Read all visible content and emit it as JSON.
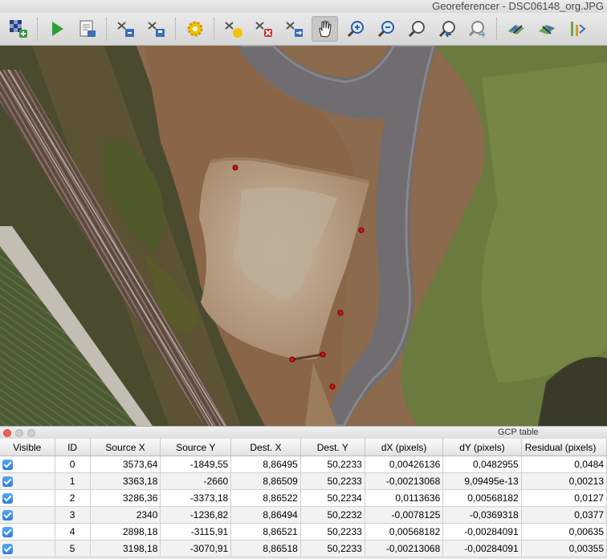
{
  "window": {
    "title": "Georeferencer - DSC06148_org.JPG"
  },
  "toolbar": {
    "buttons": [
      {
        "name": "open-raster-button",
        "icon": "open-raster-icon"
      },
      {
        "name": "start-georeferencing-button",
        "icon": "play-icon"
      },
      {
        "name": "generate-gdal-script-button",
        "icon": "script-icon"
      },
      {
        "name": "load-gcp-points-button",
        "icon": "load-gcp-icon"
      },
      {
        "name": "save-gcp-points-button",
        "icon": "save-gcp-icon"
      },
      {
        "name": "transformation-settings-button",
        "icon": "gear-icon"
      },
      {
        "name": "add-point-button",
        "icon": "add-point-icon"
      },
      {
        "name": "delete-point-button",
        "icon": "delete-point-icon"
      },
      {
        "name": "move-gcp-point-button",
        "icon": "move-point-icon"
      },
      {
        "name": "pan-button",
        "icon": "hand-icon"
      },
      {
        "name": "zoom-in-button",
        "icon": "zoom-in-icon"
      },
      {
        "name": "zoom-out-button",
        "icon": "zoom-out-icon"
      },
      {
        "name": "zoom-to-layer-button",
        "icon": "zoom-layer-icon"
      },
      {
        "name": "zoom-last-button",
        "icon": "zoom-last-icon"
      },
      {
        "name": "zoom-next-button",
        "icon": "zoom-next-icon"
      },
      {
        "name": "link-georeferencer-to-qgis-button",
        "icon": "link-geo-icon"
      },
      {
        "name": "link-qgis-to-georeferencer-button",
        "icon": "link-qgis-icon"
      },
      {
        "name": "full-histogram-stretch-button",
        "icon": "histogram-icon"
      }
    ],
    "active": "pan-button"
  },
  "gcp_panel": {
    "title": "GCP table",
    "columns": [
      "Visible",
      "ID",
      "Source X",
      "Source Y",
      "Dest. X",
      "Dest. Y",
      "dX (pixels)",
      "dY (pixels)",
      "Residual (pixels)"
    ],
    "rows": [
      {
        "visible": true,
        "id": "0",
        "source_x": "3573,64",
        "source_y": "-1849,55",
        "dest_x": "8,86495",
        "dest_y": "50,2233",
        "dx": "0,00426136",
        "dy": "0,0482955",
        "residual": "0,0484"
      },
      {
        "visible": true,
        "id": "1",
        "source_x": "3363,18",
        "source_y": "-2660",
        "dest_x": "8,86509",
        "dest_y": "50,2233",
        "dx": "-0,00213068",
        "dy": "9,09495e-13",
        "residual": "0,00213"
      },
      {
        "visible": true,
        "id": "2",
        "source_x": "3286,36",
        "source_y": "-3373,18",
        "dest_x": "8,86522",
        "dest_y": "50,2234",
        "dx": "0,0113636",
        "dy": "0,00568182",
        "residual": "0,0127"
      },
      {
        "visible": true,
        "id": "3",
        "source_x": "2340",
        "source_y": "-1236,82",
        "dest_x": "8,86494",
        "dest_y": "50,2232",
        "dx": "-0,0078125",
        "dy": "-0,0369318",
        "residual": "0,0377"
      },
      {
        "visible": true,
        "id": "4",
        "source_x": "2898,18",
        "source_y": "-3115,91",
        "dest_x": "8,86521",
        "dest_y": "50,2233",
        "dx": "0,00568182",
        "dy": "-0,00284091",
        "residual": "0,00635"
      },
      {
        "visible": true,
        "id": "5",
        "source_x": "3198,18",
        "source_y": "-3070,91",
        "dest_x": "8,86518",
        "dest_y": "50,2233",
        "dx": "-0,00213068",
        "dy": "-0,00284091",
        "residual": "0,00355"
      }
    ]
  },
  "colors": {
    "gcp_marker": "#e01010",
    "checkbox": "#2a7fe0",
    "close_button": "#ee5f57"
  }
}
